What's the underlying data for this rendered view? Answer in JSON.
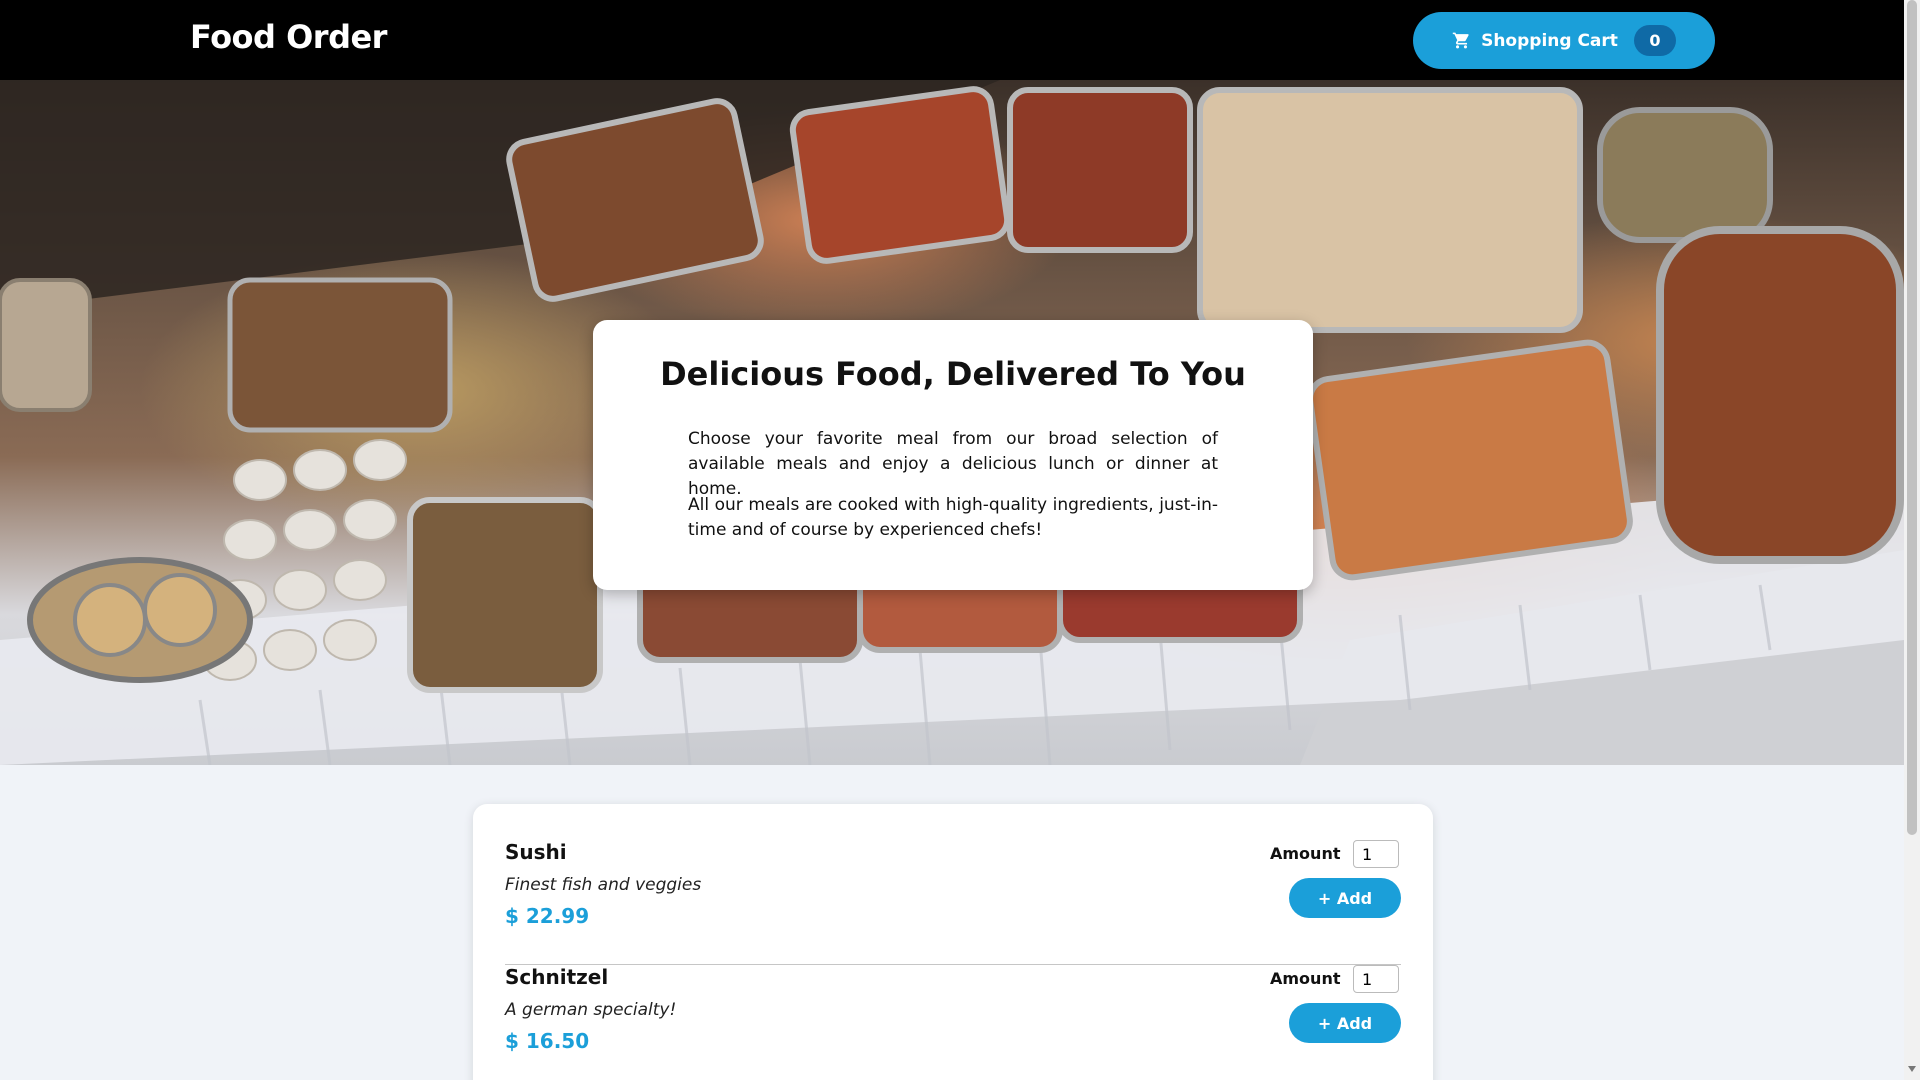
{
  "header": {
    "brand": "Food Order",
    "cart_label": "Shopping Cart",
    "cart_count": "0",
    "cart_icon": "cart-icon"
  },
  "hero": {
    "image": "buffet-table-photo",
    "title": "Delicious Food, Delivered To You",
    "paragraph_1": "Choose your favorite meal from our broad selection of available meals and enjoy a delicious lunch or dinner at home.",
    "paragraph_2": "All our meals are cooked with high-quality ingredients, just-in-time and of course by experienced chefs!"
  },
  "meals": [
    {
      "name": "Sushi",
      "description": "Finest fish and veggies",
      "price": "$ 22.99",
      "amount_label": "Amount",
      "amount_value": "1",
      "add_label": "+ Add"
    },
    {
      "name": "Schnitzel",
      "description": "A german specialty!",
      "price": "$ 16.50",
      "amount_label": "Amount",
      "amount_value": "1",
      "add_label": "+ Add"
    }
  ],
  "colors": {
    "accent": "#1b9fd9",
    "badge": "#0f6aa6",
    "header_bg": "#000000",
    "page_bg": "#f0f3f8"
  }
}
